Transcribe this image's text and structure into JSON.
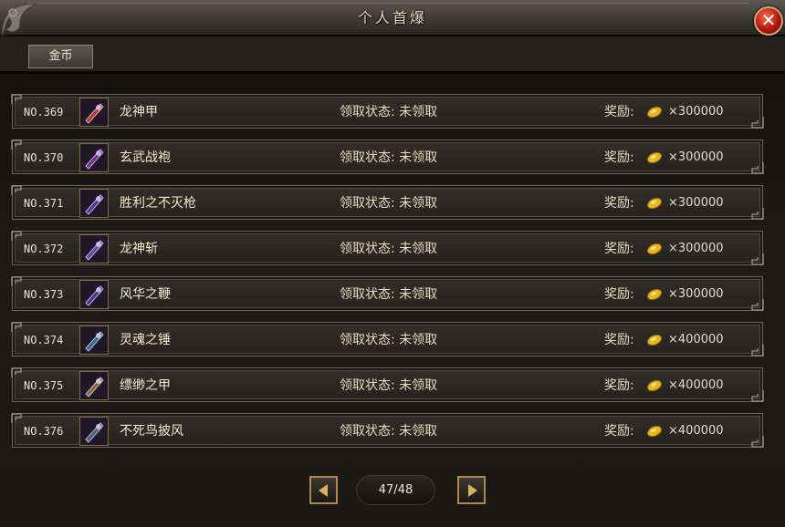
{
  "window": {
    "title": "个人首爆"
  },
  "tabs": [
    {
      "label": "金币",
      "active": true
    }
  ],
  "status_prefix": "领取状态: ",
  "reward_label": "奖励:",
  "reward_prefix": "×",
  "rows": [
    {
      "no": "NO.369",
      "item_name": "龙神甲",
      "status": "未领取",
      "reward_amount": "300000",
      "icon": "armor-item-icon"
    },
    {
      "no": "NO.370",
      "item_name": "玄武战袍",
      "status": "未领取",
      "reward_amount": "300000",
      "icon": "robe-item-icon"
    },
    {
      "no": "NO.371",
      "item_name": "胜利之不灭枪",
      "status": "未领取",
      "reward_amount": "300000",
      "icon": "spear-item-icon"
    },
    {
      "no": "NO.372",
      "item_name": "龙神斩",
      "status": "未领取",
      "reward_amount": "300000",
      "icon": "blade-item-icon"
    },
    {
      "no": "NO.373",
      "item_name": "风华之鞭",
      "status": "未领取",
      "reward_amount": "300000",
      "icon": "whip-item-icon"
    },
    {
      "no": "NO.374",
      "item_name": "灵魂之锤",
      "status": "未领取",
      "reward_amount": "400000",
      "icon": "hammer-item-icon"
    },
    {
      "no": "NO.375",
      "item_name": "缥缈之甲",
      "status": "未领取",
      "reward_amount": "400000",
      "icon": "armor-item-icon"
    },
    {
      "no": "NO.376",
      "item_name": "不死鸟披风",
      "status": "未领取",
      "reward_amount": "400000",
      "icon": "cloak-item-icon"
    }
  ],
  "pager": {
    "current_page": "47",
    "total_pages": "48",
    "display": "47/48"
  },
  "colors": {
    "accent_gold": "#d9b35c",
    "close_red": "#b4160e",
    "text_cream": "#f3e9cc"
  }
}
